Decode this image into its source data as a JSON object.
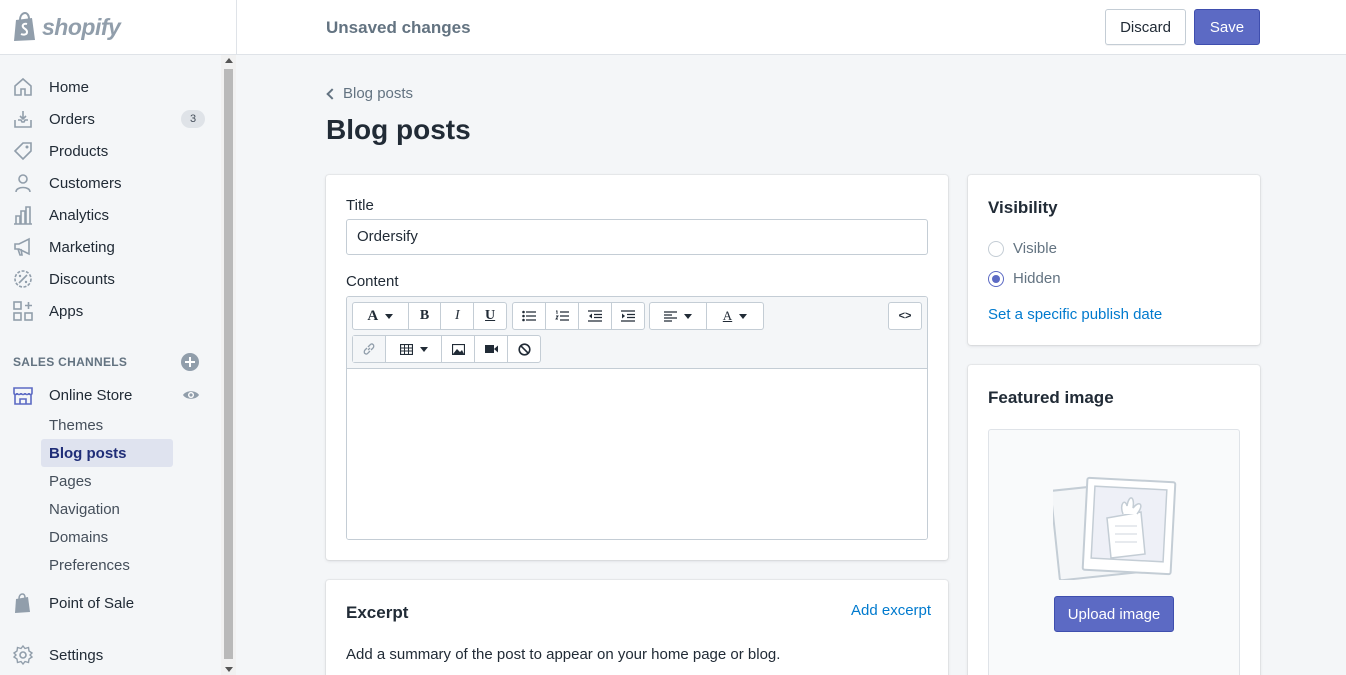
{
  "topbar": {
    "brand": "shopify",
    "status": "Unsaved changes",
    "discard_label": "Discard",
    "save_label": "Save"
  },
  "sidebar": {
    "items": [
      {
        "label": "Home",
        "icon": "home-icon"
      },
      {
        "label": "Orders",
        "icon": "orders-icon",
        "badge": "3"
      },
      {
        "label": "Products",
        "icon": "tag-icon"
      },
      {
        "label": "Customers",
        "icon": "person-icon"
      },
      {
        "label": "Analytics",
        "icon": "bar-chart-icon"
      },
      {
        "label": "Marketing",
        "icon": "megaphone-icon"
      },
      {
        "label": "Discounts",
        "icon": "discount-icon"
      },
      {
        "label": "Apps",
        "icon": "apps-icon"
      }
    ],
    "sales_channels_title": "SALES CHANNELS",
    "online_store": "Online Store",
    "sub_items": [
      "Themes",
      "Blog posts",
      "Pages",
      "Navigation",
      "Domains",
      "Preferences"
    ],
    "active_sub_item": "Blog posts",
    "point_of_sale": "Point of Sale",
    "settings": "Settings"
  },
  "main": {
    "breadcrumb": "Blog posts",
    "page_title": "Blog posts",
    "title_label": "Title",
    "title_value": "Ordersify",
    "content_label": "Content",
    "excerpt": {
      "heading": "Excerpt",
      "add_link": "Add excerpt",
      "description": "Add a summary of the post to appear on your home page or blog."
    }
  },
  "visibility": {
    "heading": "Visibility",
    "options": [
      "Visible",
      "Hidden"
    ],
    "selected": "Hidden",
    "publish_link": "Set a specific publish date"
  },
  "featured_image": {
    "heading": "Featured image",
    "upload_label": "Upload image"
  },
  "colors": {
    "accent": "#5c6ac4",
    "link": "#007ace",
    "active_nav_bg": "#dfe3ef"
  }
}
